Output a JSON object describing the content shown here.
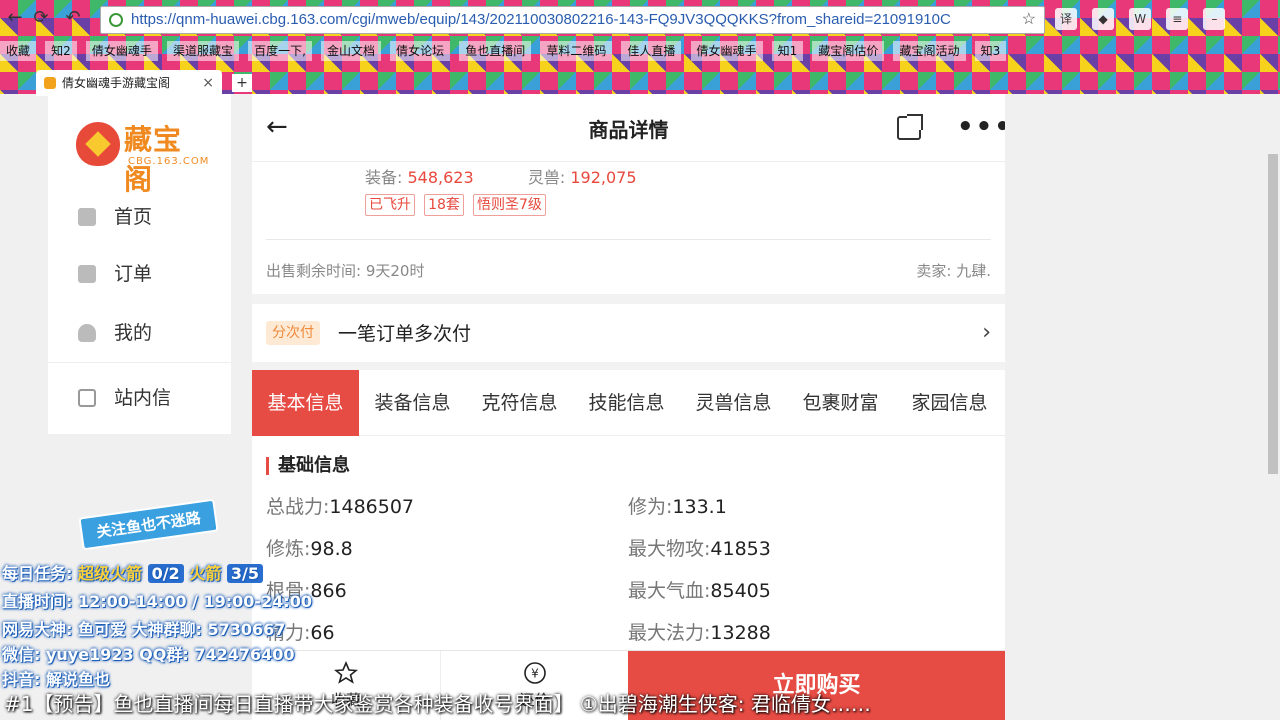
{
  "browser": {
    "url": "https://qnm-huawei.cbg.163.com/cgi/mweb/equip/143/202110030802216-143-FQ9JV3QQQKKS?from_shareid=21091910C",
    "bookmarks": [
      "收藏",
      "知2",
      "倩女幽魂手",
      "渠道服藏宝",
      "百度一下,",
      "金山文档",
      "倩女论坛",
      "鱼也直播间",
      "草料二维码",
      "佳人直播",
      "倩女幽魂手",
      "知1",
      "藏宝阁估价",
      "藏宝阁活动",
      "知3"
    ],
    "tab_title": "倩女幽魂手游藏宝阁",
    "new_tab": "+",
    "close": "×"
  },
  "sidebar": {
    "logo_text": "藏宝阁",
    "logo_sub": "CBG.163.COM",
    "items": [
      {
        "label": "首页"
      },
      {
        "label": "订单"
      },
      {
        "label": "我的"
      },
      {
        "label": "站内信"
      }
    ]
  },
  "header": {
    "title": "商品详情",
    "back": "←",
    "more": "•••"
  },
  "item": {
    "equip_label": "装备:",
    "equip_value": "548,623",
    "pet_label": "灵兽:",
    "pet_value": "192,075",
    "tags": [
      "已飞升",
      "18套",
      "悟则圣7级"
    ],
    "time_left": "出售剩余时间: 9天20时",
    "seller": "卖家: 九肆."
  },
  "installment": {
    "badge": "分次付",
    "text": "一笔订单多次付",
    "chevron": "›"
  },
  "tabs": [
    "基本信息",
    "装备信息",
    "克符信息",
    "技能信息",
    "灵兽信息",
    "包裹财富",
    "家园信息"
  ],
  "basic": {
    "title": "基础信息",
    "rows": [
      {
        "k": "总战力:",
        "v": "1486507"
      },
      {
        "k": "修为:",
        "v": "133.1"
      },
      {
        "k": "修炼:",
        "v": "98.8"
      },
      {
        "k": "最大物攻:",
        "v": "41853"
      },
      {
        "k": "根骨:",
        "v": "866"
      },
      {
        "k": "最大气血:",
        "v": "85405"
      },
      {
        "k": "精力:",
        "v": "66"
      },
      {
        "k": "最大法力:",
        "v": "13288"
      }
    ]
  },
  "bottom": {
    "fav": "收藏",
    "bargain": "还价",
    "buy": "立即购买"
  },
  "overlay": {
    "banner": "关注鱼也不迷路",
    "task_label": "每日任务:",
    "task_super": "超级火箭",
    "task_super_count": "0/2",
    "task_rocket": "火箭",
    "task_rocket_count": "3/5",
    "live_time": "直播时间: 12:00-14:00 / 19:00-24:00",
    "netease": "网易大神: 鱼可爱   大神群聊: 5730667",
    "wechat": "微信: yuye1923   QQ群: 742476400",
    "douyin": "抖音: 解说鱼也",
    "ticker": "#1【预告】鱼也直播间每日直播带大家鉴赏各种装备收号界面】  ①出碧海潮生侠客: 君临倩女……"
  }
}
